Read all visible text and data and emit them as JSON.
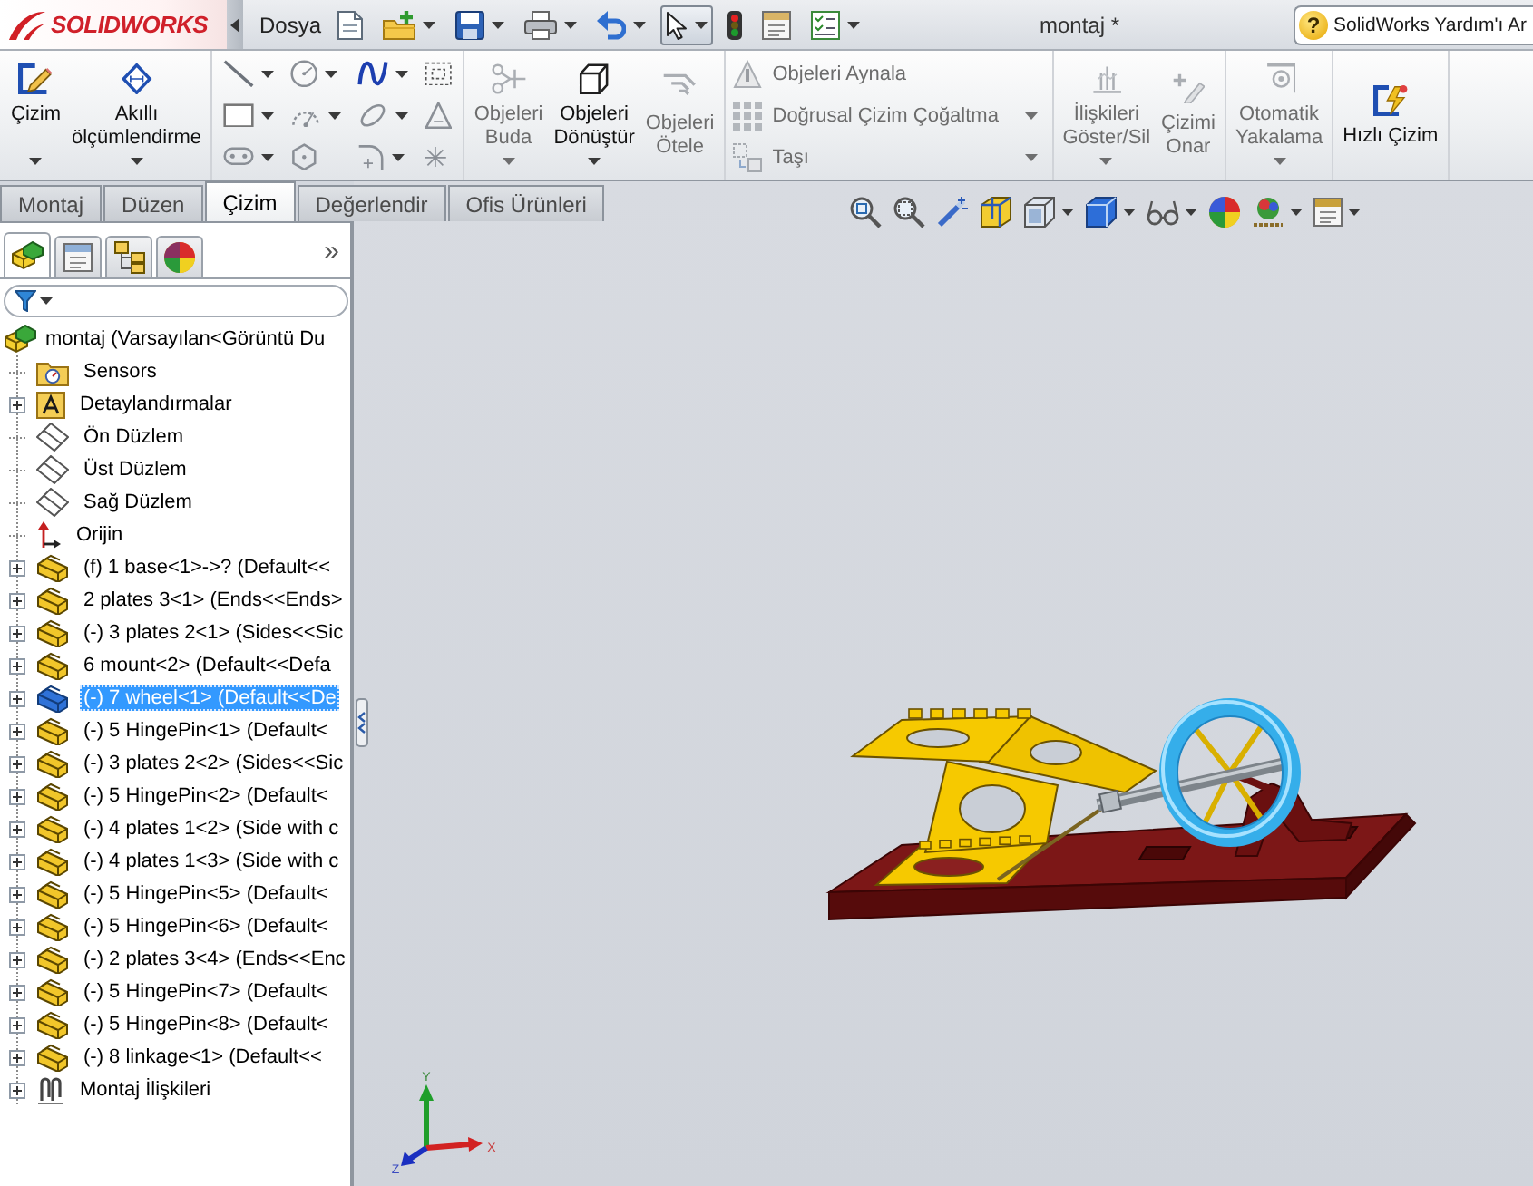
{
  "title_bar": {
    "logo": "SOLIDWORKS",
    "menu": "Dosya",
    "quick_access": [
      {
        "kind": "new",
        "dropdown": false,
        "pressed": false
      },
      {
        "kind": "open",
        "dropdown": true,
        "pressed": false
      },
      {
        "kind": "save",
        "dropdown": true,
        "pressed": false
      },
      {
        "kind": "print",
        "dropdown": true,
        "pressed": false
      },
      {
        "kind": "undo",
        "dropdown": true,
        "pressed": false
      },
      {
        "kind": "select",
        "dropdown": true,
        "pressed": true
      },
      {
        "kind": "rebuild",
        "dropdown": false,
        "pressed": false
      },
      {
        "kind": "options",
        "dropdown": false,
        "pressed": false
      },
      {
        "kind": "checklist",
        "dropdown": true,
        "pressed": false
      }
    ],
    "title": "montaj *",
    "help_search": {
      "icon": "?",
      "placeholder": "SolidWorks Yardım'ı Ar"
    }
  },
  "ribbon": {
    "sections": [
      {
        "kind": "large",
        "buttons": [
          {
            "kind": "sketch",
            "label": "Çizim",
            "disabled": false,
            "dropdown": true
          },
          {
            "kind": "smart-dimension",
            "label": "Akıllı ölçümlendirme",
            "disabled": false,
            "dropdown": true
          }
        ]
      },
      {
        "kind": "grid",
        "tools": [
          {
            "kind": "line",
            "dropdown": true
          },
          {
            "kind": "circle",
            "dropdown": true
          },
          {
            "kind": "spline",
            "dropdown": true
          },
          {
            "kind": "construction",
            "dropdown": false
          },
          {
            "kind": "rectangle",
            "dropdown": true
          },
          {
            "kind": "arc",
            "dropdown": true
          },
          {
            "kind": "ellipse",
            "dropdown": true
          },
          {
            "kind": "text",
            "dropdown": false
          },
          {
            "kind": "slot",
            "dropdown": true
          },
          {
            "kind": "polygon",
            "dropdown": false
          },
          {
            "kind": "fillet",
            "dropdown": true
          },
          {
            "kind": "point",
            "dropdown": false
          }
        ]
      },
      {
        "kind": "large",
        "buttons": [
          {
            "kind": "trim",
            "label": "Objeleri Buda",
            "disabled": true,
            "dropdown": true
          },
          {
            "kind": "convert",
            "label": "Objeleri Dönüştür",
            "disabled": false,
            "dropdown": true
          },
          {
            "kind": "offset",
            "label": "Objeleri Ötele",
            "disabled": true,
            "dropdown": false
          }
        ]
      },
      {
        "kind": "stack",
        "buttons": [
          {
            "kind": "mirror",
            "label": "Objeleri Aynala",
            "disabled": true,
            "dropdown": false
          },
          {
            "kind": "linear-pattern",
            "label": "Doğrusal Çizim Çoğaltma",
            "disabled": true,
            "dropdown": true
          },
          {
            "kind": "move",
            "label": "Taşı",
            "disabled": true,
            "dropdown": true
          }
        ]
      },
      {
        "kind": "large",
        "buttons": [
          {
            "kind": "relations",
            "label": "İlişkileri Göster/Sil",
            "disabled": true,
            "dropdown": true
          },
          {
            "kind": "repair",
            "label": "Çizimi Onar",
            "disabled": true,
            "dropdown": false
          }
        ]
      },
      {
        "kind": "large",
        "buttons": [
          {
            "kind": "quick-snaps",
            "label": "Otomatik Yakalama",
            "disabled": true,
            "dropdown": true
          }
        ]
      },
      {
        "kind": "large-oneline",
        "buttons": [
          {
            "kind": "rapid-sketch",
            "label": "Hızlı Çizim",
            "disabled": false,
            "dropdown": false
          }
        ]
      }
    ]
  },
  "command_tabs": [
    {
      "label": "Montaj",
      "selected": false
    },
    {
      "label": "Düzen",
      "selected": false
    },
    {
      "label": "Çizim",
      "selected": true
    },
    {
      "label": "Değerlendir",
      "selected": false
    },
    {
      "label": "Ofis Ürünleri",
      "selected": false
    }
  ],
  "feature_manager": {
    "tabs": [
      {
        "kind": "feature-tree",
        "selected": true
      },
      {
        "kind": "property-manager",
        "selected": false
      },
      {
        "kind": "configuration-manager",
        "selected": false
      },
      {
        "kind": "display-manager",
        "selected": false
      }
    ],
    "more": "»",
    "tree": {
      "root": {
        "label": "montaj (Varsayılan<Görüntü Du",
        "kind": "assembly",
        "selected": false,
        "children": [
          {
            "label": "Sensors",
            "kind": "sensors",
            "expandable": false,
            "selected": false
          },
          {
            "label": "Detaylandırmalar",
            "kind": "annotations",
            "expandable": true,
            "selected": false
          },
          {
            "label": "Ön Düzlem",
            "kind": "plane",
            "expandable": false,
            "selected": false
          },
          {
            "label": "Üst Düzlem",
            "kind": "plane",
            "expandable": false,
            "selected": false
          },
          {
            "label": "Sağ Düzlem",
            "kind": "plane",
            "expandable": false,
            "selected": false
          },
          {
            "label": "Orijin",
            "kind": "origin",
            "expandable": false,
            "selected": false
          },
          {
            "label": "(f) 1 base<1>->? (Default<<",
            "kind": "part",
            "expandable": true,
            "selected": false
          },
          {
            "label": "2 plates 3<1> (Ends<<Ends>",
            "kind": "part",
            "expandable": true,
            "selected": false
          },
          {
            "label": "(-) 3 plates 2<1> (Sides<<Sic",
            "kind": "part",
            "expandable": true,
            "selected": false
          },
          {
            "label": "6 mount<2> (Default<<Defa",
            "kind": "part",
            "expandable": true,
            "selected": false
          },
          {
            "label": "(-) 7 wheel<1> (Default<<De",
            "kind": "part",
            "expandable": true,
            "selected": true
          },
          {
            "label": "(-) 5 HingePin<1> (Default<",
            "kind": "part",
            "expandable": true,
            "selected": false
          },
          {
            "label": "(-) 3 plates 2<2> (Sides<<Sic",
            "kind": "part",
            "expandable": true,
            "selected": false
          },
          {
            "label": "(-) 5 HingePin<2> (Default<",
            "kind": "part",
            "expandable": true,
            "selected": false
          },
          {
            "label": "(-) 4 plates 1<2> (Side with c",
            "kind": "part",
            "expandable": true,
            "selected": false
          },
          {
            "label": "(-) 4 plates 1<3> (Side with c",
            "kind": "part",
            "expandable": true,
            "selected": false
          },
          {
            "label": "(-) 5 HingePin<5> (Default<",
            "kind": "part",
            "expandable": true,
            "selected": false
          },
          {
            "label": "(-) 5 HingePin<6> (Default<",
            "kind": "part",
            "expandable": true,
            "selected": false
          },
          {
            "label": "(-) 2 plates 3<4> (Ends<<Enc",
            "kind": "part",
            "expandable": true,
            "selected": false
          },
          {
            "label": "(-) 5 HingePin<7> (Default<",
            "kind": "part",
            "expandable": true,
            "selected": false
          },
          {
            "label": "(-) 5 HingePin<8> (Default<",
            "kind": "part",
            "expandable": true,
            "selected": false
          },
          {
            "label": "(-) 8 linkage<1> (Default<<",
            "kind": "part",
            "expandable": true,
            "selected": false
          },
          {
            "label": "Montaj İlişkileri",
            "kind": "mates",
            "expandable": true,
            "selected": false
          }
        ]
      }
    }
  },
  "viewport": {
    "toolbar": [
      {
        "kind": "zoom-fit",
        "dropdown": false
      },
      {
        "kind": "zoom-area",
        "dropdown": false
      },
      {
        "kind": "previous-view",
        "dropdown": false
      },
      {
        "kind": "section-view",
        "dropdown": false
      },
      {
        "kind": "view-orientation",
        "dropdown": true
      },
      {
        "kind": "display-style",
        "dropdown": true
      },
      {
        "kind": "hide-show",
        "dropdown": true
      },
      {
        "kind": "edit-appearance",
        "dropdown": false
      },
      {
        "kind": "apply-scene",
        "dropdown": true
      },
      {
        "kind": "view-settings",
        "dropdown": true
      }
    ],
    "triad": {
      "labels": [
        "Y",
        "X",
        "Z"
      ]
    }
  }
}
